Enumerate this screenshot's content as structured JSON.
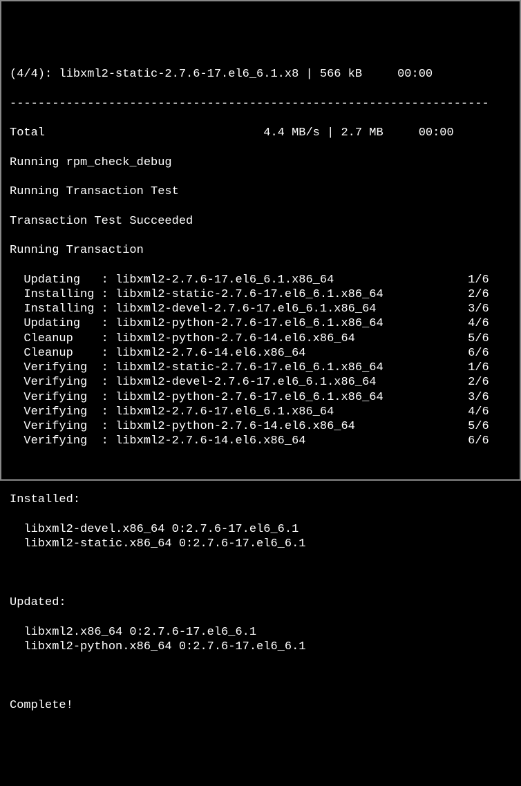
{
  "download_line": "(4/4): libxml2-static-2.7.6-17.el6_6.1.x8 | 566 kB     00:00",
  "separator": "--------------------------------------------------------------------",
  "total_line": "Total                               4.4 MB/s | 2.7 MB     00:00",
  "status_lines": [
    "Running rpm_check_debug",
    "Running Transaction Test",
    "Transaction Test Succeeded",
    "Running Transaction"
  ],
  "transactions": [
    {
      "action": "Updating  ",
      "pkg": "libxml2-2.7.6-17.el6_6.1.x86_64",
      "progress": "1/6"
    },
    {
      "action": "Installing",
      "pkg": "libxml2-static-2.7.6-17.el6_6.1.x86_64",
      "progress": "2/6"
    },
    {
      "action": "Installing",
      "pkg": "libxml2-devel-2.7.6-17.el6_6.1.x86_64",
      "progress": "3/6"
    },
    {
      "action": "Updating  ",
      "pkg": "libxml2-python-2.7.6-17.el6_6.1.x86_64",
      "progress": "4/6"
    },
    {
      "action": "Cleanup   ",
      "pkg": "libxml2-python-2.7.6-14.el6.x86_64",
      "progress": "5/6"
    },
    {
      "action": "Cleanup   ",
      "pkg": "libxml2-2.7.6-14.el6.x86_64",
      "progress": "6/6"
    },
    {
      "action": "Verifying ",
      "pkg": "libxml2-static-2.7.6-17.el6_6.1.x86_64",
      "progress": "1/6"
    },
    {
      "action": "Verifying ",
      "pkg": "libxml2-devel-2.7.6-17.el6_6.1.x86_64",
      "progress": "2/6"
    },
    {
      "action": "Verifying ",
      "pkg": "libxml2-python-2.7.6-17.el6_6.1.x86_64",
      "progress": "3/6"
    },
    {
      "action": "Verifying ",
      "pkg": "libxml2-2.7.6-17.el6_6.1.x86_64",
      "progress": "4/6"
    },
    {
      "action": "Verifying ",
      "pkg": "libxml2-python-2.7.6-14.el6.x86_64",
      "progress": "5/6"
    },
    {
      "action": "Verifying ",
      "pkg": "libxml2-2.7.6-14.el6.x86_64",
      "progress": "6/6"
    }
  ],
  "installed_header": "Installed:",
  "installed": [
    "libxml2-devel.x86_64 0:2.7.6-17.el6_6.1",
    "libxml2-static.x86_64 0:2.7.6-17.el6_6.1"
  ],
  "updated_header": "Updated:",
  "updated": [
    "libxml2.x86_64 0:2.7.6-17.el6_6.1",
    "libxml2-python.x86_64 0:2.7.6-17.el6_6.1"
  ],
  "complete": "Complete!"
}
